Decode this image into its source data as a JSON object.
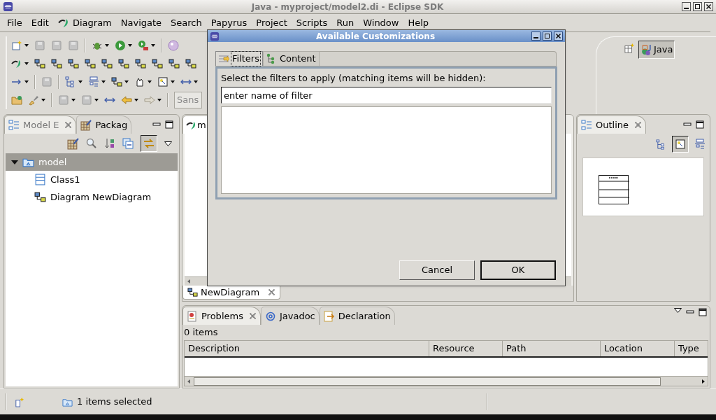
{
  "window": {
    "title": "Java - myproject/model2.di - Eclipse SDK"
  },
  "menu": [
    {
      "label": "File",
      "kind": "plain"
    },
    {
      "label": "Edit",
      "kind": "plain"
    },
    {
      "label": "Diagram",
      "kind": "logo"
    },
    {
      "label": "Navigate",
      "kind": "plain"
    },
    {
      "label": "Search",
      "kind": "plain"
    },
    {
      "label": "Papyrus",
      "kind": "plain"
    },
    {
      "label": "Project",
      "kind": "plain"
    },
    {
      "label": "Scripts",
      "kind": "plain"
    },
    {
      "label": "Run",
      "kind": "plain"
    },
    {
      "label": "Window",
      "kind": "plain"
    },
    {
      "label": "Help",
      "kind": "plain"
    }
  ],
  "toolbar": {
    "font_combo": "Sans"
  },
  "perspectives": [
    {
      "label": "Java",
      "selected": true
    }
  ],
  "model_explorer": {
    "tabs": [
      {
        "label": "Model E",
        "selected": true
      },
      {
        "label": "Packag",
        "selected": false
      }
    ],
    "tree": [
      {
        "label": "model",
        "kind": "model",
        "expanded": true,
        "selected": true,
        "children": [
          {
            "label": "Class1",
            "kind": "class",
            "selected": false
          },
          {
            "label": "Diagram NewDiagram",
            "kind": "diagram",
            "selected": false
          }
        ]
      }
    ]
  },
  "editor": {
    "tabs": [
      {
        "label": "m",
        "selected": true
      }
    ],
    "page_tabs": [
      {
        "label": "NewDiagram",
        "selected": true
      }
    ]
  },
  "outline": {
    "tabs": [
      {
        "label": "Outline",
        "selected": true
      }
    ]
  },
  "problems": {
    "tabs": [
      {
        "label": "Problems",
        "kind": "problems",
        "selected": true
      },
      {
        "label": "Javadoc",
        "kind": "javadoc",
        "selected": false
      },
      {
        "label": "Declaration",
        "kind": "declaration",
        "selected": false
      }
    ],
    "summary": "0 items",
    "columns": [
      "Description",
      "Resource",
      "Path",
      "Location",
      "Type"
    ]
  },
  "status_bar": {
    "message": "1 items selected"
  },
  "dialog": {
    "title": "Available Customizations",
    "tabs": [
      {
        "label": "Filters",
        "kind": "filters",
        "selected": true
      },
      {
        "label": "Content",
        "kind": "content",
        "selected": false
      }
    ],
    "instruction": "Select the filters to apply (matching items will be hidden):",
    "filter_field": {
      "value": "enter name of filter"
    },
    "buttons": [
      {
        "label": "Cancel",
        "default": false
      },
      {
        "label": "OK",
        "default": true
      }
    ]
  }
}
